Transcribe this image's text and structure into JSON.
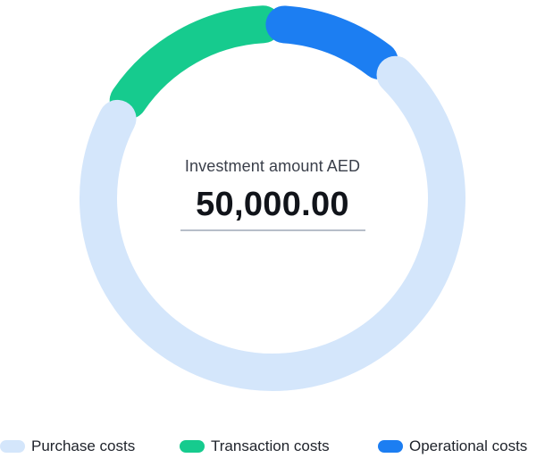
{
  "chart_data": {
    "type": "pie",
    "style": "donut",
    "center": {
      "label": "Investment amount AED",
      "value": "50,000.00"
    },
    "series": [
      {
        "name": "Purchase costs",
        "color": "#d4e6fb",
        "value": 67
      },
      {
        "name": "Transaction costs",
        "color": "#16cb8e",
        "value": 14
      },
      {
        "name": "Operational costs",
        "color": "#1c7ef2",
        "value": 9
      }
    ],
    "legend": "bottom"
  }
}
